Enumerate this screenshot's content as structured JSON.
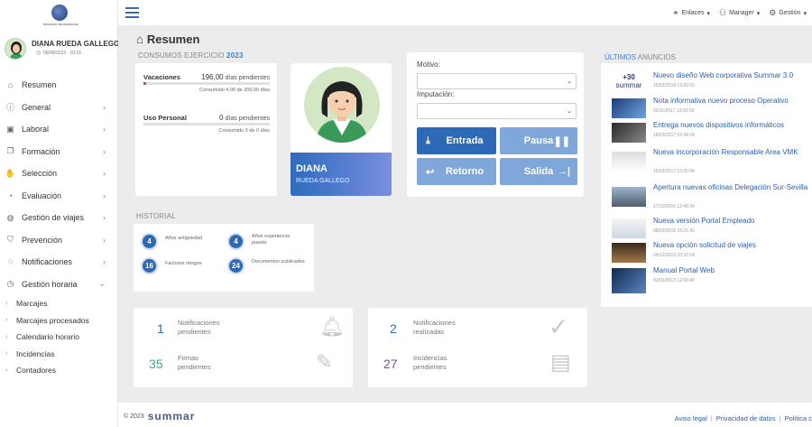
{
  "brand": {
    "logo_text": "MUNICIPIO DE PEDROCHE"
  },
  "user": {
    "name": "DIANA RUEDA GALLEGO",
    "datetime": "06/09/2023 - 10:16"
  },
  "sidebar": {
    "items": [
      {
        "label": "Resumen",
        "icon": "home-icon",
        "chevron": ""
      },
      {
        "label": "General",
        "icon": "info-icon",
        "chevron": "›"
      },
      {
        "label": "Laboral",
        "icon": "briefcase-icon",
        "chevron": "›"
      },
      {
        "label": "Formación",
        "icon": "book-icon",
        "chevron": "›"
      },
      {
        "label": "Selección",
        "icon": "handshake-icon",
        "chevron": "›"
      },
      {
        "label": "Evaluación",
        "icon": "gauge-icon",
        "chevron": "›"
      },
      {
        "label": "Gestión de viajes",
        "icon": "globe-icon",
        "chevron": "›"
      },
      {
        "label": "Prevención",
        "icon": "shield-icon",
        "chevron": "›"
      },
      {
        "label": "Notificaciones",
        "icon": "bell-icon",
        "chevron": "›"
      },
      {
        "label": "Gestión horaria",
        "icon": "clock-icon",
        "chevron": "⌄"
      }
    ],
    "sub_items": [
      "Marcajes",
      "Marcajes procesados",
      "Calendario horario",
      "Incidencias",
      "Contadores"
    ]
  },
  "topbar": {
    "links": [
      "Enlaces",
      "Manager",
      "Gestión"
    ]
  },
  "page": {
    "title": "Resumen"
  },
  "consumos": {
    "label": "CONSUMOS EJERCICIO",
    "year": "2023",
    "rows": [
      {
        "title": "Vacaciones",
        "value": "196,00",
        "unit": "días pendientes",
        "sub": "Consumido 4,00 de 200,00 días",
        "consumed_fraction": 0.02
      },
      {
        "title": "Uso Personal",
        "value": "0",
        "unit": "días pendientes",
        "sub": "Consumido 0 de 0 días",
        "consumed_fraction": 0
      }
    ]
  },
  "profile": {
    "first": "DIANA",
    "last": "RUEDA GALLEGO"
  },
  "fichaje": {
    "motivo_label": "Motivo:",
    "imputacion_label": "Imputación:",
    "buttons": {
      "entrada": "Entrada",
      "pausa": "Pausa",
      "retorno": "Retorno",
      "salida": "Salida"
    }
  },
  "historial": {
    "label": "HISTORIAL",
    "stats": [
      {
        "value": "4",
        "label": "Años antigüedad"
      },
      {
        "value": "4",
        "label": "Años experiencia puesto"
      },
      {
        "value": "16",
        "label": "Factores riesgos"
      },
      {
        "value": "24",
        "label": "Documentos publicados"
      }
    ]
  },
  "notifications": {
    "left": [
      {
        "value": "1",
        "label": "Notificaciones pendientes",
        "color": "#2d69b6"
      },
      {
        "value": "35",
        "label": "Firmas pendientes",
        "color": "#3aa58a"
      }
    ],
    "right": [
      {
        "value": "2",
        "label": "Notificaciones realizadas",
        "color": "#2d69b6"
      },
      {
        "value": "27",
        "label": "Incidencias pendientes",
        "color": "#7a4ea8"
      }
    ]
  },
  "anuncios": {
    "title_a": "ÚLTIMOS",
    "title_b": "ANUNCIOS",
    "thumb_logo_a": "+30",
    "thumb_logo_b": "summar",
    "items": [
      {
        "text": "Nuevo diseño Web corporativa Summar 3.0",
        "date": "15/01/2018 13:26:02"
      },
      {
        "text": "Nota informativa nuevo proceso Operativo",
        "date": "03/11/2017 13:53:50"
      },
      {
        "text": "Entrega nuevos dispositivos informáticos",
        "date": "18/03/2017 15:44:24"
      },
      {
        "text": "Nueva incorporación Responsable Area VMK",
        "date": "15/02/2017 13:00:04"
      },
      {
        "text": "Apertura nuevas oficinas Delegación Sur-Sevilla",
        "date": "17/10/2016 12:45:34"
      },
      {
        "text": "Nueva versión Portal Empleado",
        "date": "08/02/2016 16:21:42"
      },
      {
        "text": "Nueva opción solicitud de viajes",
        "date": "24/12/2013 10:32:18"
      },
      {
        "text": "Manual Portal Web",
        "date": "01/01/2013 12:00:45"
      }
    ]
  },
  "footer": {
    "copyright": "© 2023",
    "brand": "summar",
    "links": [
      "Aviso legal",
      "Privacidad de datos",
      "Política c"
    ]
  },
  "colors": {
    "accent": "#3a82d6",
    "primary_button": "#2d69b6",
    "disabled_button": "#7fa7d9"
  }
}
